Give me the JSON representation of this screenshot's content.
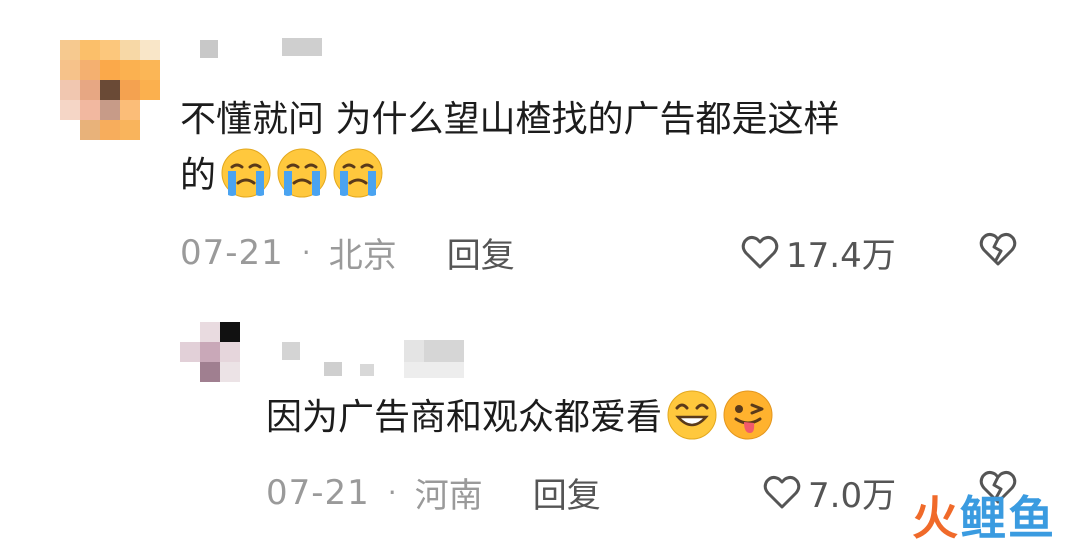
{
  "comments": {
    "main": {
      "text_line1": "不懂就问 为什么望山楂找的广告都是这样",
      "text_line2": "的",
      "emojis": [
        "crying-emoji",
        "crying-emoji",
        "crying-emoji"
      ],
      "date": "07-21",
      "separator": "·",
      "location": "北京",
      "reply_label": "回复",
      "likes": "17.4万"
    },
    "reply": {
      "text": "因为广告商和观众都爱看",
      "emojis": [
        "grin-emoji",
        "tongue-wink-emoji"
      ],
      "date": "07-21",
      "separator": "·",
      "location": "河南",
      "reply_label": "回复",
      "likes": "7.0万"
    }
  },
  "watermark": {
    "part1": "火",
    "part2": "鲤鱼"
  },
  "colors": {
    "meta_gray": "#9a9a9a",
    "icon_gray": "#555555",
    "text": "#1c1c1c",
    "emoji_yellow": "#ffc83d",
    "emoji_tear": "#4aa3f0",
    "watermark_orange": "#f06a2a",
    "watermark_blue": "#3a9be0"
  }
}
